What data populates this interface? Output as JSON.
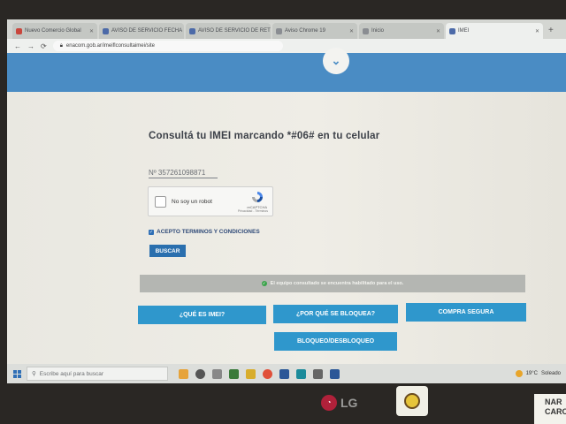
{
  "browser": {
    "tabs": [
      {
        "label": "Nuevo Comercio Global",
        "favicon": "red"
      },
      {
        "label": "AVISO DE SERVICIO FECHA",
        "favicon": "blue"
      },
      {
        "label": "AVISO DE SERVICIO DE RET",
        "favicon": "blue"
      },
      {
        "label": "Aviso Chrome 19",
        "favicon": "grey"
      },
      {
        "label": "Inicio",
        "favicon": "grey"
      },
      {
        "label": "IMEI",
        "favicon": "blue",
        "active": true
      }
    ],
    "new_tab": "+",
    "url": "enacom.gob.ar/imeiflconsultaimei/site"
  },
  "page": {
    "title": "Consultá tu IMEI marcando *#06# en tu celular",
    "imei_value": "Nº 357261098871",
    "recaptcha": {
      "label": "No soy un robot",
      "brand": "reCAPTCHA",
      "terms": "Privacidad - Términos"
    },
    "terms_label": "ACEPTO TERMINOS Y CONDICIONES",
    "search_button": "BUSCAR",
    "status_message": "El equipo consultado se encuentra habilitado para el uso.",
    "buttons": {
      "que_es_imei": "¿QUÉ ES IMEI?",
      "por_que_bloquea": "¿POR QUÉ SE BLOQUEA?",
      "compra_segura": "COMPRA SEGURA",
      "bloqueo": "BLOQUEO/DESBLOQUEO"
    }
  },
  "taskbar": {
    "search_placeholder": "Escribe aquí para buscar",
    "weather": "19°C",
    "weather_desc": "Soleado"
  },
  "monitor": {
    "brand": "LG",
    "note_text": "NAR CARO"
  },
  "colors": {
    "band_blue": "#4a8cc4",
    "button_blue": "#2f97cc",
    "buscar_blue": "#2a6fae",
    "status_grey": "#b4b6b2"
  }
}
